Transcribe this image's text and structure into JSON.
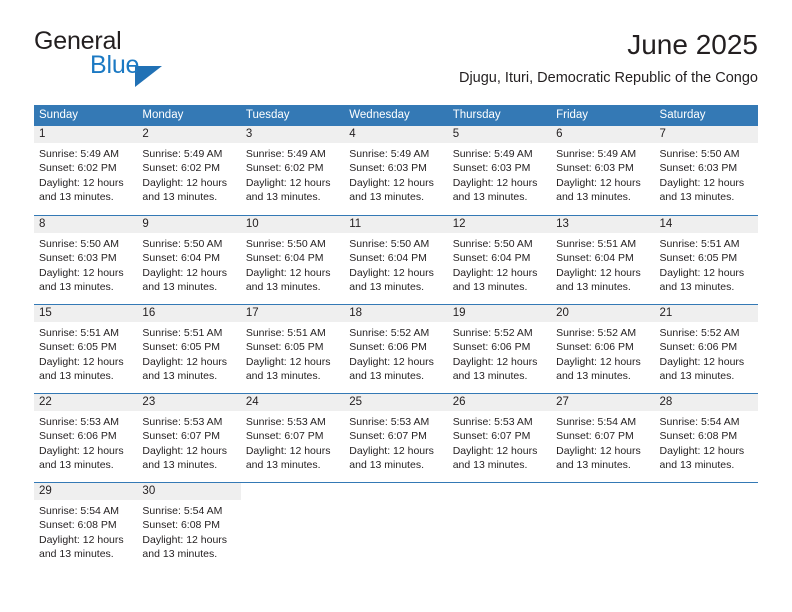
{
  "brand": {
    "word_one": "General",
    "word_two": "Blue",
    "logo_icon": "triangle-logo-icon",
    "accent_color": "#2171b5"
  },
  "header": {
    "month_title": "June 2025",
    "location": "Djugu, Ituri, Democratic Republic of the Congo"
  },
  "calendar": {
    "header_color": "#3479b5",
    "day_band_color": "#efefef",
    "weekdays": [
      "Sunday",
      "Monday",
      "Tuesday",
      "Wednesday",
      "Thursday",
      "Friday",
      "Saturday"
    ],
    "weeks": [
      [
        {
          "day": "1",
          "sunrise": "Sunrise: 5:49 AM",
          "sunset": "Sunset: 6:02 PM",
          "daylight_a": "Daylight: 12 hours",
          "daylight_b": "and 13 minutes."
        },
        {
          "day": "2",
          "sunrise": "Sunrise: 5:49 AM",
          "sunset": "Sunset: 6:02 PM",
          "daylight_a": "Daylight: 12 hours",
          "daylight_b": "and 13 minutes."
        },
        {
          "day": "3",
          "sunrise": "Sunrise: 5:49 AM",
          "sunset": "Sunset: 6:02 PM",
          "daylight_a": "Daylight: 12 hours",
          "daylight_b": "and 13 minutes."
        },
        {
          "day": "4",
          "sunrise": "Sunrise: 5:49 AM",
          "sunset": "Sunset: 6:03 PM",
          "daylight_a": "Daylight: 12 hours",
          "daylight_b": "and 13 minutes."
        },
        {
          "day": "5",
          "sunrise": "Sunrise: 5:49 AM",
          "sunset": "Sunset: 6:03 PM",
          "daylight_a": "Daylight: 12 hours",
          "daylight_b": "and 13 minutes."
        },
        {
          "day": "6",
          "sunrise": "Sunrise: 5:49 AM",
          "sunset": "Sunset: 6:03 PM",
          "daylight_a": "Daylight: 12 hours",
          "daylight_b": "and 13 minutes."
        },
        {
          "day": "7",
          "sunrise": "Sunrise: 5:50 AM",
          "sunset": "Sunset: 6:03 PM",
          "daylight_a": "Daylight: 12 hours",
          "daylight_b": "and 13 minutes."
        }
      ],
      [
        {
          "day": "8",
          "sunrise": "Sunrise: 5:50 AM",
          "sunset": "Sunset: 6:03 PM",
          "daylight_a": "Daylight: 12 hours",
          "daylight_b": "and 13 minutes."
        },
        {
          "day": "9",
          "sunrise": "Sunrise: 5:50 AM",
          "sunset": "Sunset: 6:04 PM",
          "daylight_a": "Daylight: 12 hours",
          "daylight_b": "and 13 minutes."
        },
        {
          "day": "10",
          "sunrise": "Sunrise: 5:50 AM",
          "sunset": "Sunset: 6:04 PM",
          "daylight_a": "Daylight: 12 hours",
          "daylight_b": "and 13 minutes."
        },
        {
          "day": "11",
          "sunrise": "Sunrise: 5:50 AM",
          "sunset": "Sunset: 6:04 PM",
          "daylight_a": "Daylight: 12 hours",
          "daylight_b": "and 13 minutes."
        },
        {
          "day": "12",
          "sunrise": "Sunrise: 5:50 AM",
          "sunset": "Sunset: 6:04 PM",
          "daylight_a": "Daylight: 12 hours",
          "daylight_b": "and 13 minutes."
        },
        {
          "day": "13",
          "sunrise": "Sunrise: 5:51 AM",
          "sunset": "Sunset: 6:04 PM",
          "daylight_a": "Daylight: 12 hours",
          "daylight_b": "and 13 minutes."
        },
        {
          "day": "14",
          "sunrise": "Sunrise: 5:51 AM",
          "sunset": "Sunset: 6:05 PM",
          "daylight_a": "Daylight: 12 hours",
          "daylight_b": "and 13 minutes."
        }
      ],
      [
        {
          "day": "15",
          "sunrise": "Sunrise: 5:51 AM",
          "sunset": "Sunset: 6:05 PM",
          "daylight_a": "Daylight: 12 hours",
          "daylight_b": "and 13 minutes."
        },
        {
          "day": "16",
          "sunrise": "Sunrise: 5:51 AM",
          "sunset": "Sunset: 6:05 PM",
          "daylight_a": "Daylight: 12 hours",
          "daylight_b": "and 13 minutes."
        },
        {
          "day": "17",
          "sunrise": "Sunrise: 5:51 AM",
          "sunset": "Sunset: 6:05 PM",
          "daylight_a": "Daylight: 12 hours",
          "daylight_b": "and 13 minutes."
        },
        {
          "day": "18",
          "sunrise": "Sunrise: 5:52 AM",
          "sunset": "Sunset: 6:06 PM",
          "daylight_a": "Daylight: 12 hours",
          "daylight_b": "and 13 minutes."
        },
        {
          "day": "19",
          "sunrise": "Sunrise: 5:52 AM",
          "sunset": "Sunset: 6:06 PM",
          "daylight_a": "Daylight: 12 hours",
          "daylight_b": "and 13 minutes."
        },
        {
          "day": "20",
          "sunrise": "Sunrise: 5:52 AM",
          "sunset": "Sunset: 6:06 PM",
          "daylight_a": "Daylight: 12 hours",
          "daylight_b": "and 13 minutes."
        },
        {
          "day": "21",
          "sunrise": "Sunrise: 5:52 AM",
          "sunset": "Sunset: 6:06 PM",
          "daylight_a": "Daylight: 12 hours",
          "daylight_b": "and 13 minutes."
        }
      ],
      [
        {
          "day": "22",
          "sunrise": "Sunrise: 5:53 AM",
          "sunset": "Sunset: 6:06 PM",
          "daylight_a": "Daylight: 12 hours",
          "daylight_b": "and 13 minutes."
        },
        {
          "day": "23",
          "sunrise": "Sunrise: 5:53 AM",
          "sunset": "Sunset: 6:07 PM",
          "daylight_a": "Daylight: 12 hours",
          "daylight_b": "and 13 minutes."
        },
        {
          "day": "24",
          "sunrise": "Sunrise: 5:53 AM",
          "sunset": "Sunset: 6:07 PM",
          "daylight_a": "Daylight: 12 hours",
          "daylight_b": "and 13 minutes."
        },
        {
          "day": "25",
          "sunrise": "Sunrise: 5:53 AM",
          "sunset": "Sunset: 6:07 PM",
          "daylight_a": "Daylight: 12 hours",
          "daylight_b": "and 13 minutes."
        },
        {
          "day": "26",
          "sunrise": "Sunrise: 5:53 AM",
          "sunset": "Sunset: 6:07 PM",
          "daylight_a": "Daylight: 12 hours",
          "daylight_b": "and 13 minutes."
        },
        {
          "day": "27",
          "sunrise": "Sunrise: 5:54 AM",
          "sunset": "Sunset: 6:07 PM",
          "daylight_a": "Daylight: 12 hours",
          "daylight_b": "and 13 minutes."
        },
        {
          "day": "28",
          "sunrise": "Sunrise: 5:54 AM",
          "sunset": "Sunset: 6:08 PM",
          "daylight_a": "Daylight: 12 hours",
          "daylight_b": "and 13 minutes."
        }
      ],
      [
        {
          "day": "29",
          "sunrise": "Sunrise: 5:54 AM",
          "sunset": "Sunset: 6:08 PM",
          "daylight_a": "Daylight: 12 hours",
          "daylight_b": "and 13 minutes."
        },
        {
          "day": "30",
          "sunrise": "Sunrise: 5:54 AM",
          "sunset": "Sunset: 6:08 PM",
          "daylight_a": "Daylight: 12 hours",
          "daylight_b": "and 13 minutes."
        },
        {
          "day": "",
          "sunrise": "",
          "sunset": "",
          "daylight_a": "",
          "daylight_b": ""
        },
        {
          "day": "",
          "sunrise": "",
          "sunset": "",
          "daylight_a": "",
          "daylight_b": ""
        },
        {
          "day": "",
          "sunrise": "",
          "sunset": "",
          "daylight_a": "",
          "daylight_b": ""
        },
        {
          "day": "",
          "sunrise": "",
          "sunset": "",
          "daylight_a": "",
          "daylight_b": ""
        },
        {
          "day": "",
          "sunrise": "",
          "sunset": "",
          "daylight_a": "",
          "daylight_b": ""
        }
      ]
    ]
  }
}
